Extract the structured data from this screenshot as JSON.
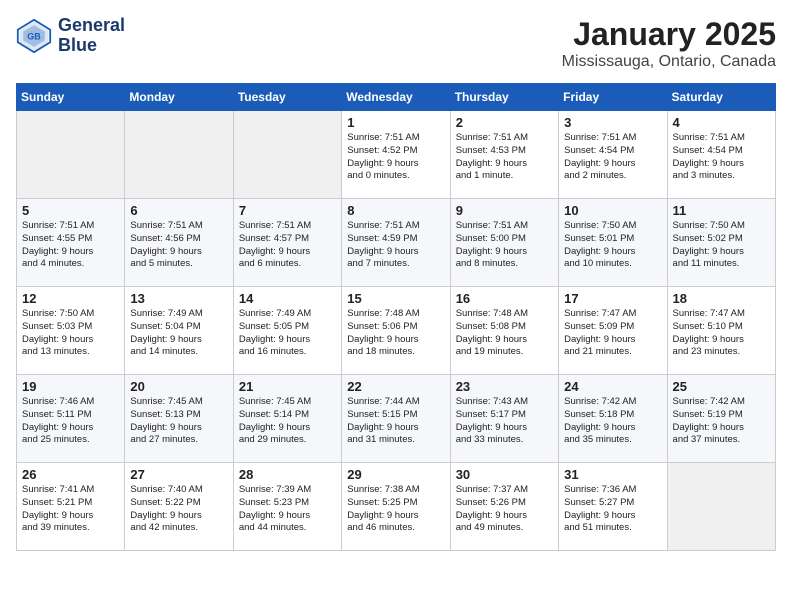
{
  "header": {
    "logo_line1": "General",
    "logo_line2": "Blue",
    "month": "January 2025",
    "location": "Mississauga, Ontario, Canada"
  },
  "days_of_week": [
    "Sunday",
    "Monday",
    "Tuesday",
    "Wednesday",
    "Thursday",
    "Friday",
    "Saturday"
  ],
  "weeks": [
    [
      {
        "day": "",
        "info": ""
      },
      {
        "day": "",
        "info": ""
      },
      {
        "day": "",
        "info": ""
      },
      {
        "day": "1",
        "info": "Sunrise: 7:51 AM\nSunset: 4:52 PM\nDaylight: 9 hours\nand 0 minutes."
      },
      {
        "day": "2",
        "info": "Sunrise: 7:51 AM\nSunset: 4:53 PM\nDaylight: 9 hours\nand 1 minute."
      },
      {
        "day": "3",
        "info": "Sunrise: 7:51 AM\nSunset: 4:54 PM\nDaylight: 9 hours\nand 2 minutes."
      },
      {
        "day": "4",
        "info": "Sunrise: 7:51 AM\nSunset: 4:54 PM\nDaylight: 9 hours\nand 3 minutes."
      }
    ],
    [
      {
        "day": "5",
        "info": "Sunrise: 7:51 AM\nSunset: 4:55 PM\nDaylight: 9 hours\nand 4 minutes."
      },
      {
        "day": "6",
        "info": "Sunrise: 7:51 AM\nSunset: 4:56 PM\nDaylight: 9 hours\nand 5 minutes."
      },
      {
        "day": "7",
        "info": "Sunrise: 7:51 AM\nSunset: 4:57 PM\nDaylight: 9 hours\nand 6 minutes."
      },
      {
        "day": "8",
        "info": "Sunrise: 7:51 AM\nSunset: 4:59 PM\nDaylight: 9 hours\nand 7 minutes."
      },
      {
        "day": "9",
        "info": "Sunrise: 7:51 AM\nSunset: 5:00 PM\nDaylight: 9 hours\nand 8 minutes."
      },
      {
        "day": "10",
        "info": "Sunrise: 7:50 AM\nSunset: 5:01 PM\nDaylight: 9 hours\nand 10 minutes."
      },
      {
        "day": "11",
        "info": "Sunrise: 7:50 AM\nSunset: 5:02 PM\nDaylight: 9 hours\nand 11 minutes."
      }
    ],
    [
      {
        "day": "12",
        "info": "Sunrise: 7:50 AM\nSunset: 5:03 PM\nDaylight: 9 hours\nand 13 minutes."
      },
      {
        "day": "13",
        "info": "Sunrise: 7:49 AM\nSunset: 5:04 PM\nDaylight: 9 hours\nand 14 minutes."
      },
      {
        "day": "14",
        "info": "Sunrise: 7:49 AM\nSunset: 5:05 PM\nDaylight: 9 hours\nand 16 minutes."
      },
      {
        "day": "15",
        "info": "Sunrise: 7:48 AM\nSunset: 5:06 PM\nDaylight: 9 hours\nand 18 minutes."
      },
      {
        "day": "16",
        "info": "Sunrise: 7:48 AM\nSunset: 5:08 PM\nDaylight: 9 hours\nand 19 minutes."
      },
      {
        "day": "17",
        "info": "Sunrise: 7:47 AM\nSunset: 5:09 PM\nDaylight: 9 hours\nand 21 minutes."
      },
      {
        "day": "18",
        "info": "Sunrise: 7:47 AM\nSunset: 5:10 PM\nDaylight: 9 hours\nand 23 minutes."
      }
    ],
    [
      {
        "day": "19",
        "info": "Sunrise: 7:46 AM\nSunset: 5:11 PM\nDaylight: 9 hours\nand 25 minutes."
      },
      {
        "day": "20",
        "info": "Sunrise: 7:45 AM\nSunset: 5:13 PM\nDaylight: 9 hours\nand 27 minutes."
      },
      {
        "day": "21",
        "info": "Sunrise: 7:45 AM\nSunset: 5:14 PM\nDaylight: 9 hours\nand 29 minutes."
      },
      {
        "day": "22",
        "info": "Sunrise: 7:44 AM\nSunset: 5:15 PM\nDaylight: 9 hours\nand 31 minutes."
      },
      {
        "day": "23",
        "info": "Sunrise: 7:43 AM\nSunset: 5:17 PM\nDaylight: 9 hours\nand 33 minutes."
      },
      {
        "day": "24",
        "info": "Sunrise: 7:42 AM\nSunset: 5:18 PM\nDaylight: 9 hours\nand 35 minutes."
      },
      {
        "day": "25",
        "info": "Sunrise: 7:42 AM\nSunset: 5:19 PM\nDaylight: 9 hours\nand 37 minutes."
      }
    ],
    [
      {
        "day": "26",
        "info": "Sunrise: 7:41 AM\nSunset: 5:21 PM\nDaylight: 9 hours\nand 39 minutes."
      },
      {
        "day": "27",
        "info": "Sunrise: 7:40 AM\nSunset: 5:22 PM\nDaylight: 9 hours\nand 42 minutes."
      },
      {
        "day": "28",
        "info": "Sunrise: 7:39 AM\nSunset: 5:23 PM\nDaylight: 9 hours\nand 44 minutes."
      },
      {
        "day": "29",
        "info": "Sunrise: 7:38 AM\nSunset: 5:25 PM\nDaylight: 9 hours\nand 46 minutes."
      },
      {
        "day": "30",
        "info": "Sunrise: 7:37 AM\nSunset: 5:26 PM\nDaylight: 9 hours\nand 49 minutes."
      },
      {
        "day": "31",
        "info": "Sunrise: 7:36 AM\nSunset: 5:27 PM\nDaylight: 9 hours\nand 51 minutes."
      },
      {
        "day": "",
        "info": ""
      }
    ]
  ]
}
